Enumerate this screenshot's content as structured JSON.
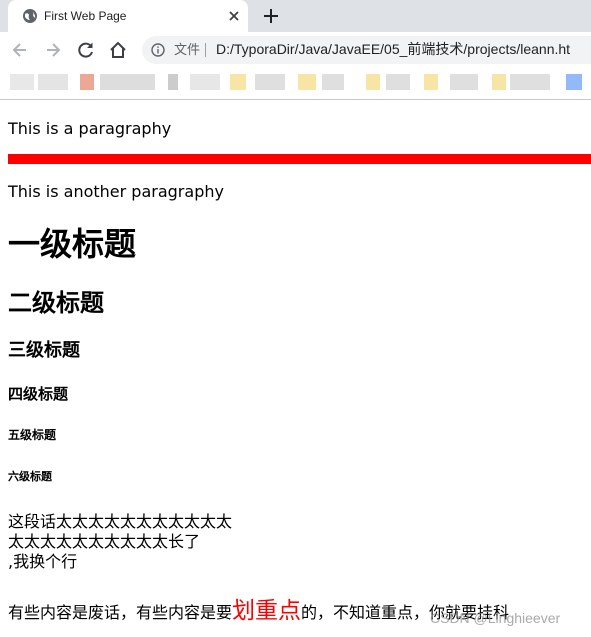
{
  "browser": {
    "tab_title": "First Web Page",
    "omnibox": {
      "file_label": "文件",
      "url": "D:/TyporaDir/Java/JavaEE/05_前端技术/projects/leann.ht"
    },
    "bookmarks_note": ""
  },
  "page": {
    "paragraph_1": "This is a paragraphy",
    "paragraph_2": "This is another paragraphy",
    "headings": {
      "h1": "一级标题",
      "h2": "二级标题",
      "h3": "三级标题",
      "h4": "四级标题",
      "h5": "五级标题",
      "h6": "六级标题"
    },
    "multiline_paragraph": [
      "这段话太太太太太太太太太太太",
      "太太太太太太太太太太长了",
      ",我换个行"
    ],
    "final_paragraph": {
      "before": "有些内容是废话，有些内容是要",
      "emphasis": "划重点",
      "after": "的，不知道重点，你就要挂科"
    },
    "watermark": "CSDN @Linghieever"
  },
  "colors": {
    "hr": "#ff0000",
    "emphasis": "#ff0000"
  }
}
